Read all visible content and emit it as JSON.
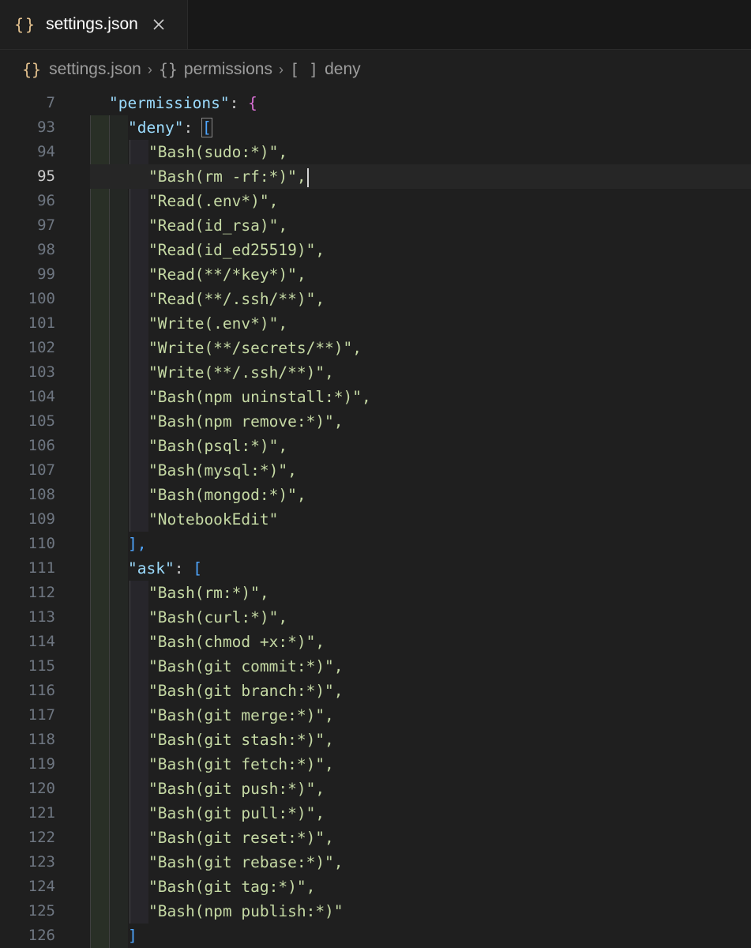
{
  "tab": {
    "label": "settings.json",
    "icon": "braces-icon"
  },
  "breadcrumb": [
    {
      "icon": "{}",
      "label": "settings.json"
    },
    {
      "icon": "{}",
      "label": "permissions"
    },
    {
      "icon": "[ ]",
      "label": "deny"
    }
  ],
  "colors": {
    "key": "#9cdcfe",
    "value": "#c5d9a4",
    "brace": "#da70d6",
    "bracket": "#4fa6ff"
  },
  "editor": {
    "active_line": "95",
    "header": {
      "line": "7",
      "key": "\"permissions\"",
      "open": "{"
    },
    "deny": {
      "line": "93",
      "key": "\"deny\"",
      "open": "[",
      "close": "],",
      "close_line": "110",
      "items": [
        {
          "line": "94",
          "text": "\"Bash(sudo:*)\","
        },
        {
          "line": "95",
          "text": "\"Bash(rm -rf:*)\","
        },
        {
          "line": "96",
          "text": "\"Read(.env*)\","
        },
        {
          "line": "97",
          "text": "\"Read(id_rsa)\","
        },
        {
          "line": "98",
          "text": "\"Read(id_ed25519)\","
        },
        {
          "line": "99",
          "text": "\"Read(**/*key*)\","
        },
        {
          "line": "100",
          "text": "\"Read(**/.ssh/**)\","
        },
        {
          "line": "101",
          "text": "\"Write(.env*)\","
        },
        {
          "line": "102",
          "text": "\"Write(**/secrets/**)\","
        },
        {
          "line": "103",
          "text": "\"Write(**/.ssh/**)\","
        },
        {
          "line": "104",
          "text": "\"Bash(npm uninstall:*)\","
        },
        {
          "line": "105",
          "text": "\"Bash(npm remove:*)\","
        },
        {
          "line": "106",
          "text": "\"Bash(psql:*)\","
        },
        {
          "line": "107",
          "text": "\"Bash(mysql:*)\","
        },
        {
          "line": "108",
          "text": "\"Bash(mongod:*)\","
        },
        {
          "line": "109",
          "text": "\"NotebookEdit\""
        }
      ]
    },
    "ask": {
      "line": "111",
      "key": "\"ask\"",
      "open": "[",
      "close": "]",
      "close_line": "126",
      "items": [
        {
          "line": "112",
          "text": "\"Bash(rm:*)\","
        },
        {
          "line": "113",
          "text": "\"Bash(curl:*)\","
        },
        {
          "line": "114",
          "text": "\"Bash(chmod +x:*)\","
        },
        {
          "line": "115",
          "text": "\"Bash(git commit:*)\","
        },
        {
          "line": "116",
          "text": "\"Bash(git branch:*)\","
        },
        {
          "line": "117",
          "text": "\"Bash(git merge:*)\","
        },
        {
          "line": "118",
          "text": "\"Bash(git stash:*)\","
        },
        {
          "line": "119",
          "text": "\"Bash(git fetch:*)\","
        },
        {
          "line": "120",
          "text": "\"Bash(git push:*)\","
        },
        {
          "line": "121",
          "text": "\"Bash(git pull:*)\","
        },
        {
          "line": "122",
          "text": "\"Bash(git reset:*)\","
        },
        {
          "line": "123",
          "text": "\"Bash(git rebase:*)\","
        },
        {
          "line": "124",
          "text": "\"Bash(git tag:*)\","
        },
        {
          "line": "125",
          "text": "\"Bash(npm publish:*)\""
        }
      ]
    }
  }
}
